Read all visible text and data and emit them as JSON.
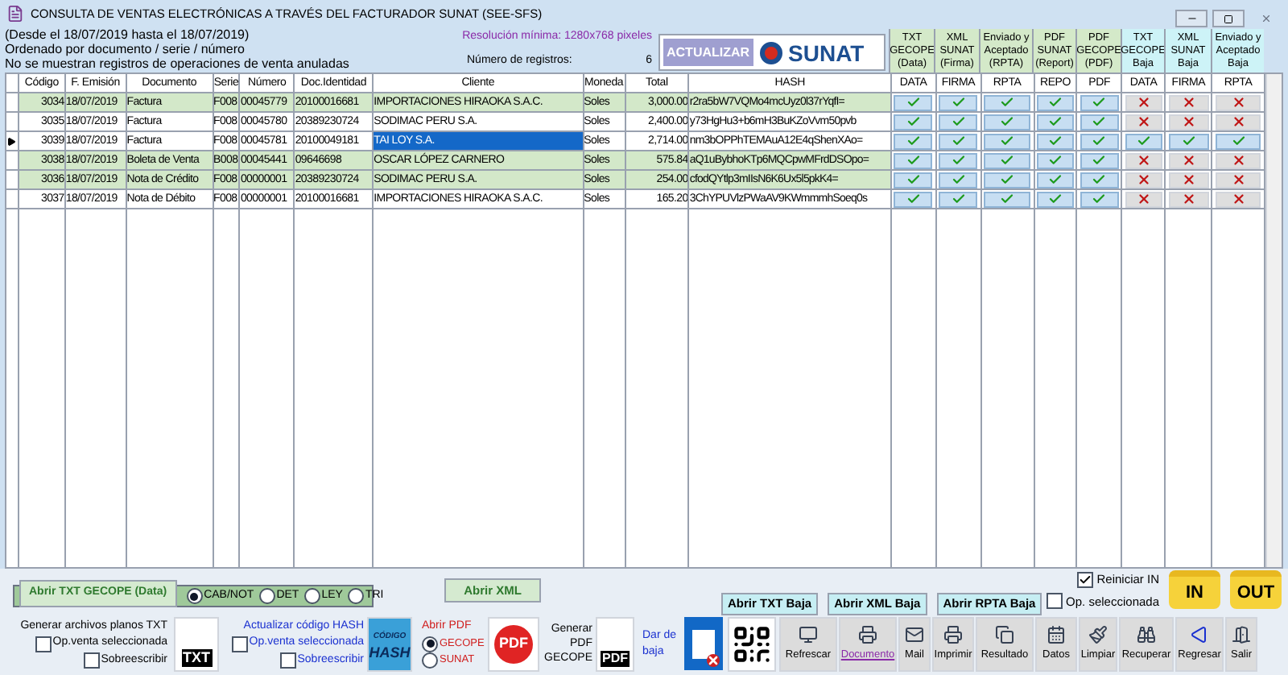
{
  "window": {
    "title": "CONSULTA DE VENTAS ELECTRÓNICAS A TRAVÉS DEL FACTURADOR SUNAT (SEE-SFS)"
  },
  "header": {
    "lines": [
      "(Desde el 18/07/2019 hasta el 18/07/2019)",
      "Ordenado por documento / serie / número",
      "No se muestran registros de operaciones de venta anuladas"
    ],
    "resolution": "Resolución mínima: 1280x768 pixeles",
    "count_label": "Número de registros:",
    "count": "6",
    "refresh_button": "ACTUALIZAR",
    "logo_text": "SUNAT"
  },
  "column_groups": [
    {
      "lines": [
        "TXT",
        "GECOPE",
        "(Data)"
      ],
      "color": "#d4e9c9"
    },
    {
      "lines": [
        "XML",
        "SUNAT",
        "(Firma)"
      ],
      "color": "#d4e9c9"
    },
    {
      "lines": [
        "Enviado y",
        "Aceptado",
        "(RPTA)"
      ],
      "color": "#d4e9c9"
    },
    {
      "lines": [
        "PDF",
        "SUNAT",
        "(Report)"
      ],
      "color": "#d4e9c9"
    },
    {
      "lines": [
        "PDF",
        "GECOPE",
        "(PDF)"
      ],
      "color": "#d4e9c9"
    },
    {
      "lines": [
        "TXT",
        "GECOPE",
        "Baja"
      ],
      "color": "#cdf3f7"
    },
    {
      "lines": [
        "XML",
        "SUNAT",
        "Baja"
      ],
      "color": "#cdf3f7"
    },
    {
      "lines": [
        "Enviado y",
        "Aceptado",
        "Baja"
      ],
      "color": "#cdf3f7"
    }
  ],
  "table": {
    "columns": [
      "Código",
      "F. Emisión",
      "Documento",
      "Serie",
      "Número",
      "Doc.Identidad",
      "Cliente",
      "Moneda",
      "Total",
      "HASH",
      "DATA",
      "FIRMA",
      "RPTA",
      "REPO",
      "PDF",
      "DATA",
      "FIRMA",
      "RPTA"
    ],
    "rows": [
      {
        "cells": [
          "3034",
          "18/07/2019",
          "Factura",
          "F008",
          "00045779",
          "20100016681",
          "IMPORTACIONES HIRAOKA S.A.C.",
          "Soles",
          "3,000.00",
          "r2ra5bW7VQMo4mcUyz0l37rYqfI="
        ],
        "status": [
          true,
          true,
          true,
          true,
          true,
          false,
          false,
          false
        ],
        "highlight": true,
        "selected": false
      },
      {
        "cells": [
          "3035",
          "18/07/2019",
          "Factura",
          "F008",
          "00045780",
          "20389230724",
          "SODIMAC PERU S.A.",
          "Soles",
          "2,400.00",
          "y73HgHu3+b6mH3BuKZoVvm50pvb"
        ],
        "status": [
          true,
          true,
          true,
          true,
          true,
          false,
          false,
          false
        ],
        "highlight": false,
        "selected": false
      },
      {
        "cells": [
          "3039",
          "18/07/2019",
          "Factura",
          "F008",
          "00045781",
          "20100049181",
          "TAI LOY S.A.",
          "Soles",
          "2,714.00",
          "nm3bOPPhTEMAuA12E4qShenXAo="
        ],
        "status": [
          true,
          true,
          true,
          true,
          true,
          true,
          true,
          true
        ],
        "highlight": false,
        "selected": true
      },
      {
        "cells": [
          "3038",
          "18/07/2019",
          "Boleta de Venta",
          "B008",
          "00045441",
          "09646698",
          "OSCAR LÓPEZ CARNERO",
          "Soles",
          "575.84",
          "aQ1uBybhoKTp6MQCpwMFrdDSOpo="
        ],
        "status": [
          true,
          true,
          true,
          true,
          true,
          false,
          false,
          false
        ],
        "highlight": true,
        "selected": false
      },
      {
        "cells": [
          "3036",
          "18/07/2019",
          "Nota de Crédito",
          "F008",
          "00000001",
          "20389230724",
          "SODIMAC PERU S.A.",
          "Soles",
          "254.00",
          "cfodQYtlp3mIIsN6K6Ux5l5pkK4="
        ],
        "status": [
          true,
          true,
          true,
          true,
          true,
          false,
          false,
          false
        ],
        "highlight": true,
        "selected": false
      },
      {
        "cells": [
          "3037",
          "18/07/2019",
          "Nota de Débito",
          "F008",
          "00000001",
          "20100016681",
          "IMPORTACIONES HIRAOKA S.A.C.",
          "Soles",
          "165.20",
          "3ChYPUVlzPWaAV9KWmmmhSoeq0s"
        ],
        "status": [
          true,
          true,
          true,
          true,
          true,
          false,
          false,
          false
        ],
        "highlight": false,
        "selected": false
      }
    ]
  },
  "txt_open": {
    "button": "Abrir TXT GECOPE (Data)",
    "options": [
      {
        "label": "CAB/NOT",
        "selected": true
      },
      {
        "label": "DET",
        "selected": false
      },
      {
        "label": "LEY",
        "selected": false
      },
      {
        "label": "TRI",
        "selected": false
      }
    ]
  },
  "xml_button": "Abrir XML",
  "baja_buttons": [
    "Abrir TXT Baja",
    "Abrir XML Baja",
    "Abrir RPTA Baja"
  ],
  "in_checks": [
    {
      "label": "Reiniciar IN",
      "checked": true
    },
    {
      "label": "Op. seleccionada",
      "checked": false
    }
  ],
  "folders": [
    "IN",
    "OUT"
  ],
  "generate_txt": {
    "label": "Generar archivos planos TXT",
    "checks": [
      {
        "label": "Op.venta seleccionada",
        "checked": false
      },
      {
        "label": "Sobreescribir",
        "checked": false
      }
    ],
    "icon_text": "TXT"
  },
  "hash": {
    "label": "Actualizar código HASH",
    "checks": [
      {
        "label": "Op.venta seleccionada",
        "checked": false
      },
      {
        "label": "Sobreescribir",
        "checked": false
      }
    ],
    "icon_lines": [
      "CÓDIGO",
      "HASH"
    ]
  },
  "pdf_open": {
    "label": "Abrir PDF",
    "options": [
      {
        "label": "GECOPE",
        "selected": true
      },
      {
        "label": "SUNAT",
        "selected": false
      }
    ],
    "icon_text": "PDF"
  },
  "pdf_generate": {
    "lines": [
      "Generar",
      "PDF",
      "GECOPE"
    ],
    "icon_text": "PDF"
  },
  "baja": {
    "lines": [
      "Dar de",
      "baja"
    ]
  },
  "toolbar": [
    {
      "label": "Refrescar",
      "kind": "refresh"
    },
    {
      "label": "Documento",
      "kind": "document"
    },
    {
      "label": "Mail",
      "kind": "mail"
    },
    {
      "label": "Imprimir",
      "kind": "print"
    },
    {
      "label": "Resultado",
      "kind": "result"
    },
    {
      "label": "Datos",
      "kind": "data"
    },
    {
      "label": "Limpiar",
      "kind": "clean"
    },
    {
      "label": "Recuperar",
      "kind": "recover"
    },
    {
      "label": "Regresar",
      "kind": "back"
    },
    {
      "label": "Salir",
      "kind": "exit"
    }
  ]
}
